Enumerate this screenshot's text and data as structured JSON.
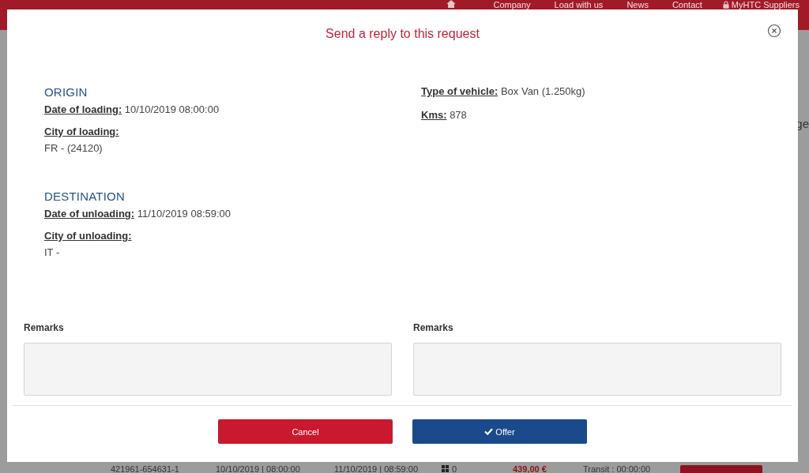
{
  "nav": {
    "items": [
      {
        "label": "Company",
        "kind": "link"
      },
      {
        "label": "Load with us",
        "kind": "link"
      },
      {
        "label": "News",
        "kind": "link"
      },
      {
        "label": "Contact",
        "kind": "link"
      },
      {
        "label": "MyHTC Suppliers",
        "kind": "account"
      }
    ]
  },
  "side_text": "ge",
  "background_row": {
    "cells": [
      "421961-654631-1",
      "10/10/2019 | 08:00:00",
      "11/10/2019 | 08:59:00",
      "0",
      "439,00 €",
      "Transit : 00:00:00"
    ]
  },
  "modal": {
    "title": "Send a reply to this request",
    "sections": [
      {
        "heading": "ORIGIN",
        "fields": [
          {
            "label": "Date of loading:",
            "value": "10/10/2019 08:00:00",
            "kind": "inline"
          },
          {
            "label": "City of loading:",
            "value": "FR - (24120)",
            "kind": "block"
          }
        ]
      },
      {
        "heading": "DESTINATION",
        "fields": [
          {
            "label": "Date of unloading:",
            "value": "11/10/2019 08:59:00",
            "kind": "inline"
          },
          {
            "label": "City of unloading:",
            "value": "IT -",
            "kind": "block"
          }
        ]
      }
    ],
    "vehicle": [
      {
        "label": "Type of vehicle:",
        "value": "Box Van (1.250kg)",
        "kind": "inline"
      },
      {
        "label": "Kms:",
        "value": "878",
        "kind": "inline"
      }
    ],
    "remarks": [
      {
        "label": "Remarks"
      },
      {
        "label": "Remarks"
      }
    ],
    "buttons": [
      {
        "label": "Cancel",
        "kind": "cancel"
      },
      {
        "label": "Offer",
        "kind": "confirm"
      }
    ]
  }
}
